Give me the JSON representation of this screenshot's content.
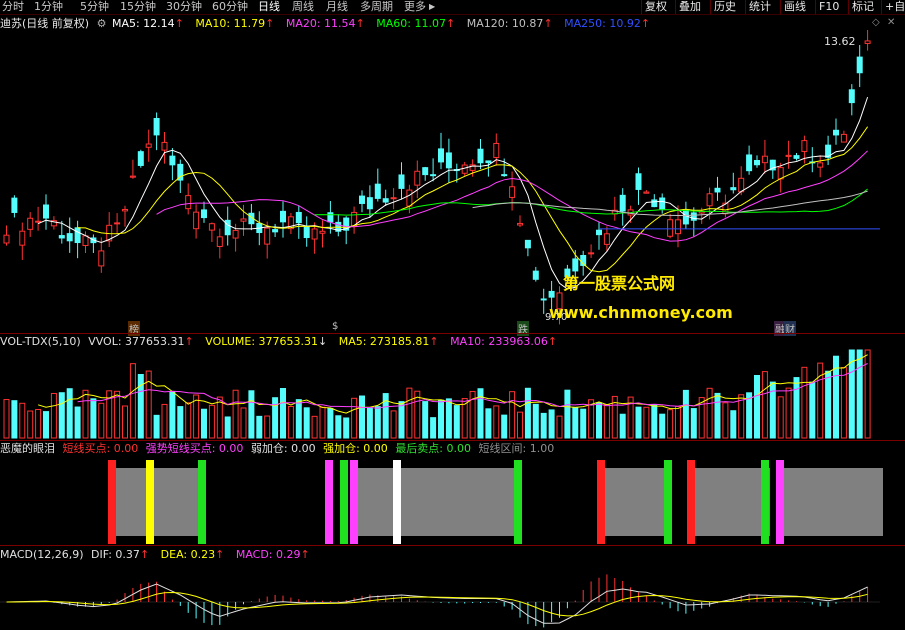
{
  "toolbar": {
    "periods": [
      "分时",
      "1分钟",
      "5分钟",
      "15分钟",
      "30分钟",
      "60分钟",
      "日线",
      "周线",
      "月线",
      "多周期",
      "更多"
    ],
    "active_period": "日线",
    "more_arrow": "▶",
    "right_buttons": [
      "复权",
      "叠加",
      "历史",
      "统计",
      "画线",
      "F10",
      "标记",
      "+自"
    ]
  },
  "main_chart": {
    "stock_title": "迪苏(日线 前复权)",
    "ma": [
      {
        "label": "MA5: 12.14",
        "color": "#ffffff"
      },
      {
        "label": "MA10: 11.79",
        "color": "#ffff00"
      },
      {
        "label": "MA20: 11.54",
        "color": "#ff40ff"
      },
      {
        "label": "MA60: 11.07",
        "color": "#00ff00"
      },
      {
        "label": "MA120: 10.87",
        "color": "#c0c0c0"
      },
      {
        "label": "MA250: 10.92",
        "color": "#3050ff"
      }
    ],
    "high_label": "13.62",
    "low_label": "9.70",
    "markers": [
      {
        "text": "榜",
        "color": "#e08020"
      },
      {
        "text": "$",
        "color": "#ff3030"
      },
      {
        "text": "跌",
        "color": "#30e030"
      },
      {
        "text": "融",
        "color": "#ff60ff"
      },
      {
        "text": "财",
        "color": "#60a0ff"
      }
    ],
    "colors": {
      "up": "#ff3232",
      "down": "#54fcfc"
    }
  },
  "watermark": {
    "title": "第一股票公式网",
    "url": "www.chnmoney.com"
  },
  "volume_panel": {
    "title": "VOL-TDX(5,10)",
    "items": [
      {
        "label": "VVOL: 377653.31",
        "color": "#e0e0e0",
        "arrow": "↑"
      },
      {
        "label": "VOLUME: 377653.31",
        "color": "#ffff00",
        "arrow": "↓"
      },
      {
        "label": "MA5: 273185.81",
        "color": "#ffff00",
        "arrow": "↑"
      },
      {
        "label": "MA10: 233963.06",
        "color": "#ff40ff",
        "arrow": "↑"
      }
    ]
  },
  "signal_panel": {
    "title": "恶魔的眼泪",
    "items": [
      {
        "label": "短线买点: 0.00",
        "color": "#ff3030"
      },
      {
        "label": "强势短线买点: 0.00",
        "color": "#ff40ff"
      },
      {
        "label": "弱加仓: 0.00",
        "color": "#e0e0e0"
      },
      {
        "label": "强加仓: 0.00",
        "color": "#ffff00"
      },
      {
        "label": "最后卖点: 0.00",
        "color": "#30e030"
      },
      {
        "label": "短线区间: 1.00",
        "color": "#909090"
      }
    ]
  },
  "macd_panel": {
    "title": "MACD(12,26,9)",
    "items": [
      {
        "label": "DIF: 0.37",
        "color": "#e0e0e0",
        "arrow": "↑"
      },
      {
        "label": "DEA: 0.23",
        "color": "#ffff00",
        "arrow": "↑"
      },
      {
        "label": "MACD: 0.29",
        "color": "#ff40ff",
        "arrow": "↑"
      }
    ]
  }
}
